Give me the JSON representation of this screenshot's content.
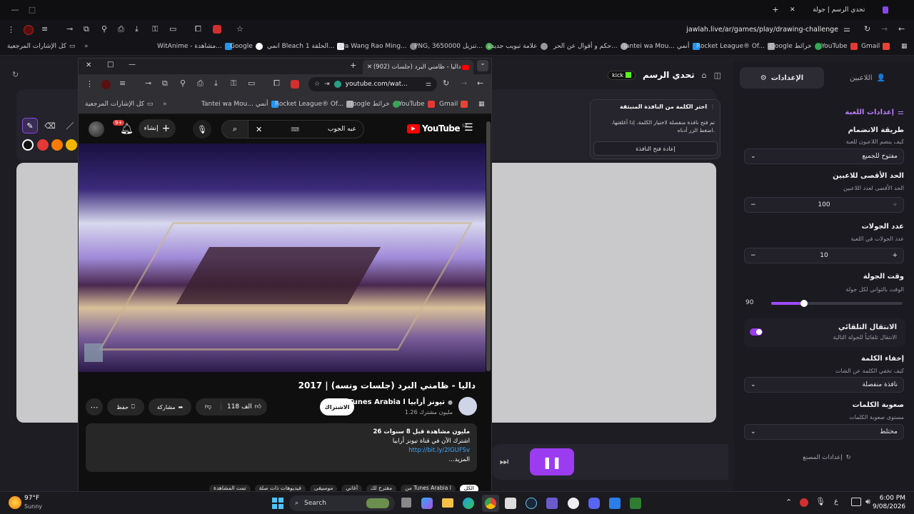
{
  "browser": {
    "tab_title": "تحدي الرسم | جولة",
    "url": "jawlah.live/ar/games/play/drawing-challenge",
    "bookmarks": [
      "كل الإشارات المرجعية",
      "WitAnime - مشاهدة...",
      "Google",
      "انمي Bleach الحلقة 1...",
      "Da Wang Rao Ming...",
      "PNG, 3650000 تنزيل...",
      "علامة تبويب جديدة",
      "حكم و أقوال عن الحر...",
      "Tantei wa Mou... أنمي",
      "Rocket League® Of...",
      "Google خرائط",
      "YouTube",
      "Gmail"
    ]
  },
  "app": {
    "title": "تحدي الرسم",
    "kick_label": "kick",
    "popup": {
      "title": "اختر الكلمة من النافذة المنبثقة",
      "body": "تم فتح نافذة منفصلة لاختيار الكلمة. إذا أغلقتها، اضغط الزر أدناه.",
      "button": "إعادة فتح النافذة"
    },
    "tabs": {
      "players": "اللاعبين",
      "settings": "الإعدادات"
    },
    "settings": {
      "section_title": "إعدادات اللعبة",
      "join_title": "طريقة الانضمام",
      "join_sub": "كيف ينضم اللاعبون للعبة",
      "join_value": "مفتوح للجميع",
      "max_title": "الحد الأقصى للاعبين",
      "max_sub": "الحد الأقصى لعدد اللاعبين",
      "max_value": "100",
      "rounds_title": "عدد الجولات",
      "rounds_sub": "عدد الجولات في اللعبة",
      "rounds_value": "10",
      "time_title": "وقت الجولة",
      "time_sub": "الوقت بالثواني لكل جولة",
      "time_value": "90",
      "time_fraction": 0.25,
      "auto_title": "الانتقال التلقائي",
      "auto_sub": "الانتقال تلقائياً للجولة التالية",
      "hide_title": "إخفاء الكلمة",
      "hide_sub": "كيف تخفي الكلمة عن الشات",
      "hide_value": "نافذة منفصلة",
      "diff_title": "صعوبة الكلمات",
      "diff_sub": "مستوى صعوبة الكلمات",
      "diff_value": "مختلط",
      "reset": "إعدادات المصنع"
    },
    "colors": [
      "#111111",
      "#e53935",
      "#f57c00",
      "#f2b600"
    ]
  },
  "yt": {
    "tab_title": "(902) داليا - ظامني البرد (جلسات",
    "url": "youtube.com/wat...",
    "bookmarks": [
      "كل الإشارات المرجعية",
      "Tantei wa Mou... أنمي",
      "Rocket League® Of...",
      "Google خرائط",
      "YouTube",
      "Gmail"
    ],
    "search_value": "عبه الجوب",
    "create_label": "إنشاء",
    "notif_count": "9+",
    "logo": "YouTube",
    "logo_sup": "SA",
    "video_title": "داليا - ظامني البرد (جلسات ونسه) | 2017",
    "channel": "Tunes Arabia l تيونز أرابيا",
    "subs": "1.26 مليون مشترك",
    "subscribe": "الاشتراك",
    "likes": "118 الف",
    "share": "مشاركة",
    "save": "حفظ",
    "desc_line1": "26 مليون مشاهدة قبل 8 سنوات",
    "desc_line2": "اشترك الآن في قناة تيونز أرابيا",
    "desc_link": "http://bit.ly/2lGUFSv",
    "desc_more": "...المزيد",
    "chips": [
      "الكل",
      "من Tunes Arabia l",
      "مقترح لك",
      "أغاني",
      "موسيقى",
      "فيديوهات ذات صلة",
      "تمت المشاهدة"
    ]
  },
  "taskbar": {
    "temp": "97°F",
    "weather": "Sunny",
    "search": "Search",
    "time": "6:00 PM",
    "date": "9/08/2026",
    "lang": "ع"
  }
}
